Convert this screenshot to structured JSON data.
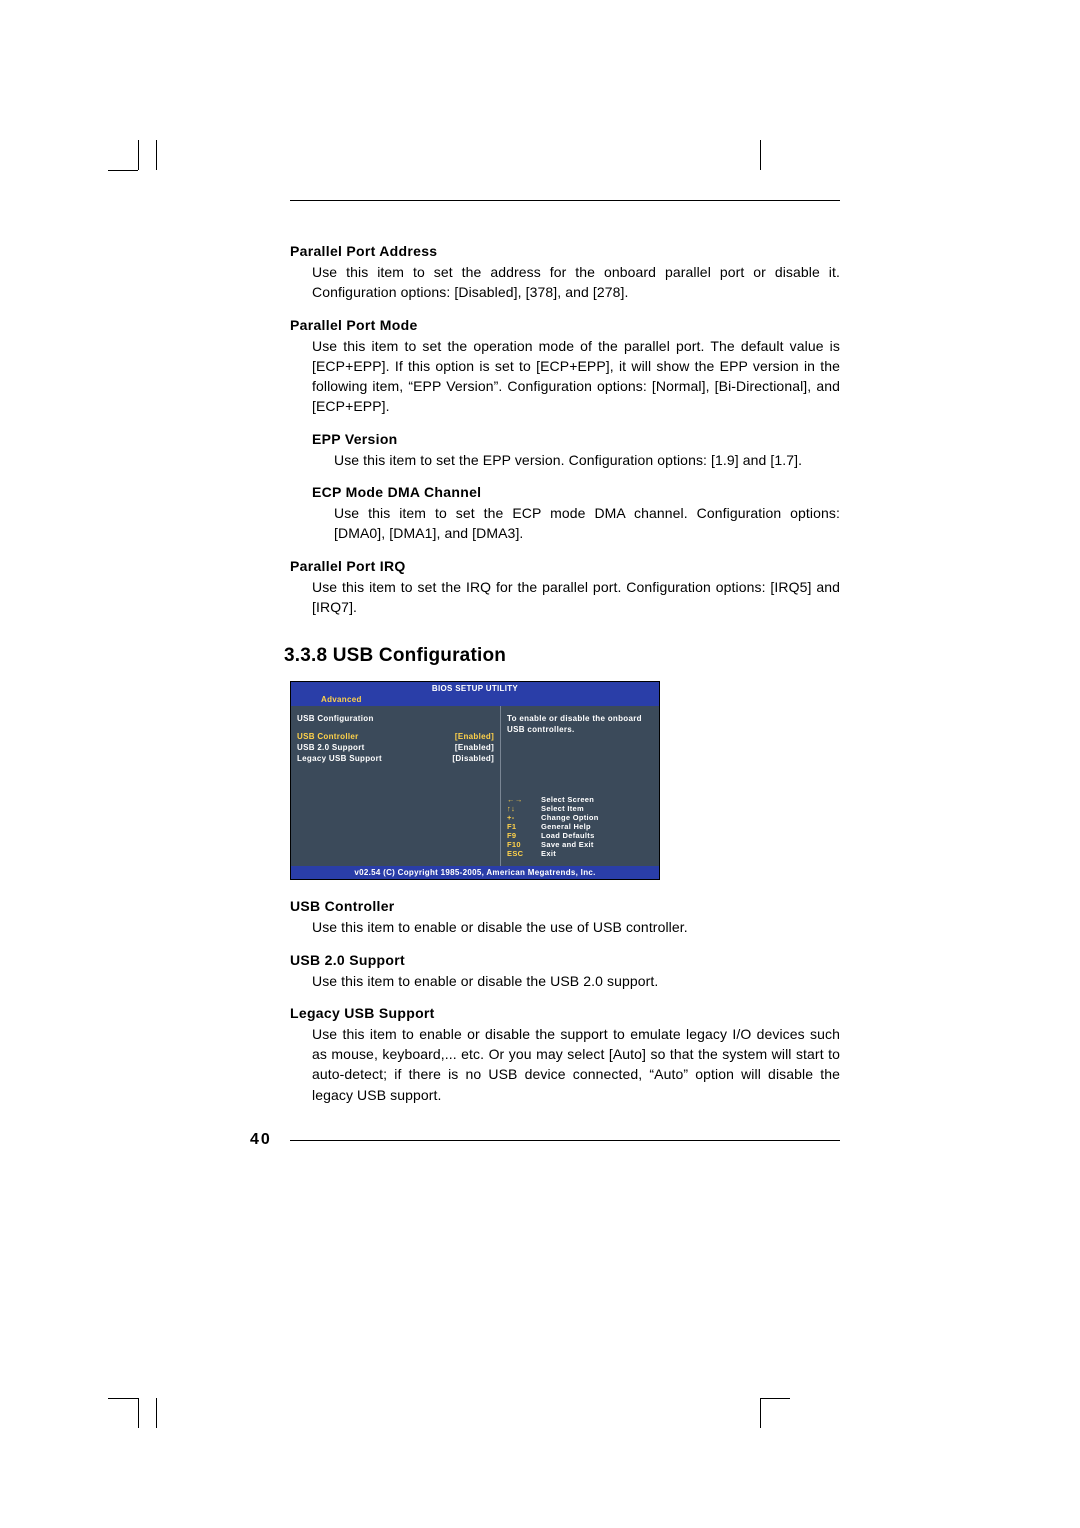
{
  "page_number": "40",
  "sections": {
    "parallel_port_address": {
      "title": "Parallel Port Address",
      "body": "Use this item to set the address for the onboard parallel port or disable it. Configuration options: [Disabled], [378], and [278]."
    },
    "parallel_port_mode": {
      "title": "Parallel Port Mode",
      "body": "Use this item to set the operation mode of the parallel port. The default value is [ECP+EPP]. If this option is set to [ECP+EPP], it will show the EPP version in the following item, “EPP Version”. Configuration options: [Normal], [Bi-Directional], and [ECP+EPP]."
    },
    "epp_version": {
      "title": "EPP Version",
      "body": "Use this item to set the EPP version. Configuration options: [1.9] and [1.7]."
    },
    "ecp_mode_dma": {
      "title": "ECP Mode DMA Channel",
      "body": "Use this item to set the ECP mode DMA channel. Configuration options: [DMA0], [DMA1], and [DMA3]."
    },
    "parallel_port_irq": {
      "title": "Parallel Port IRQ",
      "body": "Use this item to set the IRQ for the parallel port. Configuration options: [IRQ5] and [IRQ7]."
    }
  },
  "usb_heading": "3.3.8 USB Configuration",
  "bios": {
    "title": "BIOS SETUP UTILITY",
    "tab": "Advanced",
    "panel_heading": "USB Configuration",
    "rows": [
      {
        "label": "USB Controller",
        "value": "[Enabled]",
        "selected": true
      },
      {
        "label": "USB 2.0 Support",
        "value": "[Enabled]",
        "selected": false
      },
      {
        "label": "Legacy USB Support",
        "value": "[Disabled]",
        "selected": false
      }
    ],
    "help": "To enable or disable the onboard USB controllers.",
    "keys": [
      {
        "k": "←→",
        "d": "Select Screen"
      },
      {
        "k": "↑↓",
        "d": "Select Item"
      },
      {
        "k": "+-",
        "d": "Change Option"
      },
      {
        "k": "F1",
        "d": "General Help"
      },
      {
        "k": "F9",
        "d": "Load Defaults"
      },
      {
        "k": "F10",
        "d": "Save and Exit"
      },
      {
        "k": "ESC",
        "d": "Exit"
      }
    ],
    "footer": "v02.54 (C) Copyright 1985-2005, American Megatrends, Inc."
  },
  "usb_sections": {
    "usb_controller": {
      "title": "USB Controller",
      "body": "Use this item to enable or disable the use of USB controller."
    },
    "usb_20_support": {
      "title": "USB 2.0 Support",
      "body": "Use this item to enable or disable the USB 2.0 support."
    },
    "legacy_usb_support": {
      "title": "Legacy USB Support",
      "body": "Use this item to enable or disable the support to emulate legacy I/O devices such as mouse, keyboard,... etc. Or you may select [Auto] so that the system will start to auto-detect; if there is no USB  device connected,  “Auto” option will disable the legacy USB support."
    }
  }
}
